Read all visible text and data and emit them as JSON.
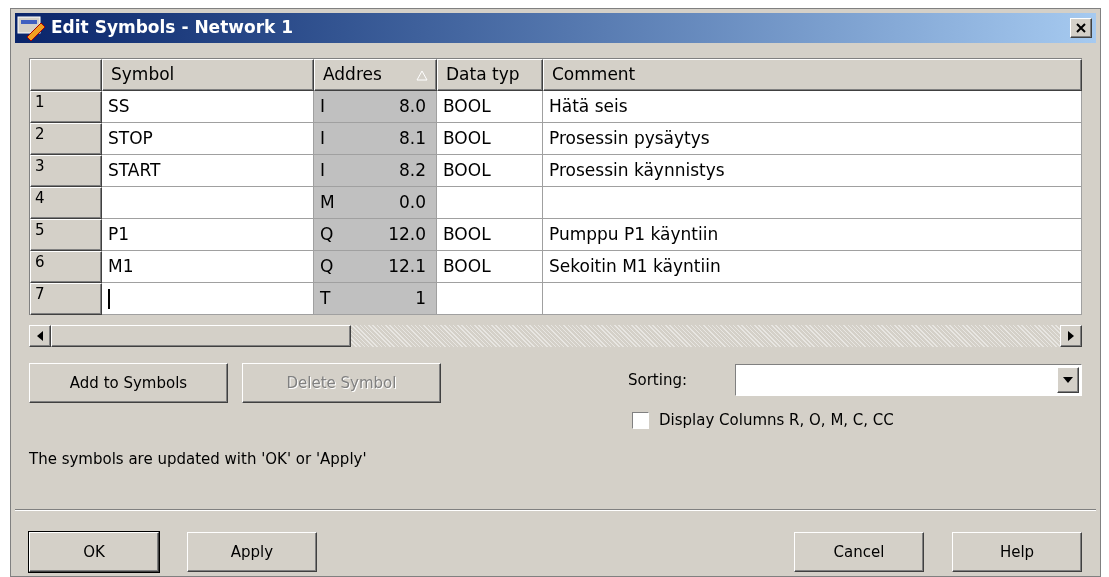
{
  "window": {
    "title": "Edit Symbols - Network 1"
  },
  "table": {
    "columns": [
      {
        "label": "Symbol"
      },
      {
        "label": "Addres",
        "sorted_ascending": true
      },
      {
        "label": "Data typ"
      },
      {
        "label": "Comment"
      }
    ],
    "rows": [
      {
        "number": "1",
        "symbol": "SS",
        "area": "I",
        "address": "8.0",
        "data_type": "BOOL",
        "comment": "Hätä seis",
        "editing": false
      },
      {
        "number": "2",
        "symbol": "STOP",
        "area": "I",
        "address": "8.1",
        "data_type": "BOOL",
        "comment": "Prosessin pysäytys",
        "editing": false
      },
      {
        "number": "3",
        "symbol": "START",
        "area": "I",
        "address": "8.2",
        "data_type": "BOOL",
        "comment": "Prosessin käynnistys",
        "editing": false
      },
      {
        "number": "4",
        "area": "M",
        "address": "0.0",
        "editing": false
      },
      {
        "number": "5",
        "symbol": "P1",
        "area": "Q",
        "address": "12.0",
        "data_type": "BOOL",
        "comment": "Pumppu P1 käyntiin",
        "editing": false
      },
      {
        "number": "6",
        "symbol": "M1",
        "area": "Q",
        "address": "12.1",
        "data_type": "BOOL",
        "comment": "Sekoitin M1 käyntiin",
        "editing": false
      },
      {
        "number": "7",
        "area": "T",
        "address": "1",
        "editing": true
      }
    ]
  },
  "actions": [
    {
      "label": "Add to Symbols",
      "disabled": false
    },
    {
      "label": "Delete Symbol",
      "disabled": true
    }
  ],
  "sorting": {
    "label": "Sorting:"
  },
  "display_columns": {
    "label": "Display Columns R, O, M, C, CC",
    "checked": false
  },
  "note": "The symbols are updated with 'OK' or  'Apply'",
  "buttons": [
    {
      "label": "OK",
      "default": true
    },
    {
      "label": "Apply",
      "default": false
    },
    {
      "label": "Cancel",
      "default": false
    },
    {
      "label": "Help",
      "default": false
    }
  ]
}
